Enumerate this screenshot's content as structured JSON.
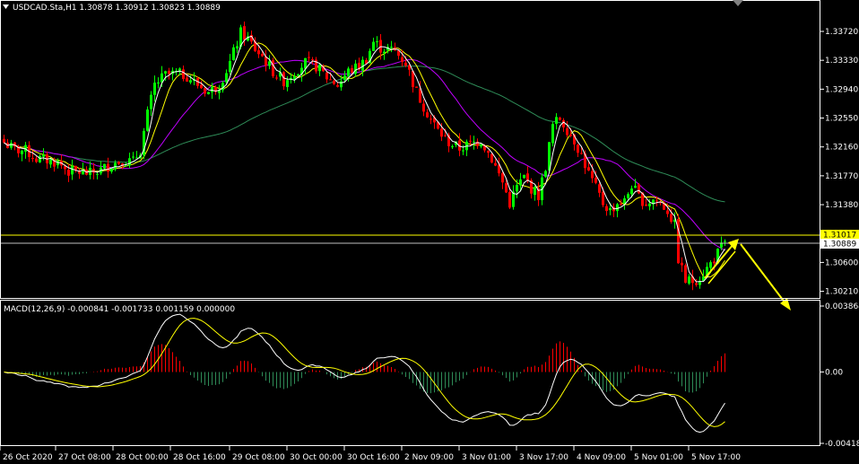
{
  "header": {
    "title": "USDCAD.Sta,H1  1.30878 1.30912 1.30823 1.30889",
    "menu_icon": "triangle-down-icon",
    "scroll_icon": "triangle-down-icon"
  },
  "colors": {
    "background": "#000000",
    "frame": "#ffffff",
    "bull_candle": "#00ff00",
    "bear_candle": "#ff0000",
    "ma_fast": "#ffffff",
    "ma_medium": "#ffff00",
    "ma_slow": "#c000ff",
    "ma_long": "#2e8b57",
    "hist_positive": "#ff0000",
    "hist_negative": "#2e8b57",
    "macd_line": "#ffffff",
    "signal_line": "#ffff00",
    "arrow": "#ffff00",
    "level_line": "#ffff00",
    "bid_line": "#c0c0c0",
    "level_label_bg": "#ffff00",
    "bid_label_bg": "#ffffff"
  },
  "price_panel": {
    "y_ticks": [
      "1.33720",
      "1.33330",
      "1.32940",
      "1.32550",
      "1.32160",
      "1.31770",
      "1.31380",
      "1.30600",
      "1.30210"
    ],
    "level_label": "1.31017",
    "bid_label": "1.30889"
  },
  "macd_panel": {
    "title": "MACD(12,26,9) -0.000841 -0.001733 0.001159 0.000000",
    "y_ticks": [
      "0.003864",
      "0.00",
      "-0.004183"
    ]
  },
  "x_axis": {
    "labels": [
      "26 Oct 2020",
      "27 Oct 08:00",
      "28 Oct 00:00",
      "28 Oct 16:00",
      "29 Oct 08:00",
      "30 Oct 00:00",
      "30 Oct 16:00",
      "2 Nov 09:00",
      "3 Nov 01:00",
      "3 Nov 17:00",
      "4 Nov 09:00",
      "5 Nov 01:00",
      "5 Nov 17:00"
    ]
  },
  "chart_data": [
    {
      "type": "candlestick",
      "title": "USDCAD.Sta,H1",
      "ohlc_last": {
        "open": 1.30878,
        "high": 1.30912,
        "low": 1.30823,
        "close": 1.30889
      },
      "ylim": [
        1.3012,
        1.3412
      ],
      "horizontal_levels": [
        1.31017,
        1.30889
      ],
      "moving_averages": 4,
      "x_labels": [
        "26 Oct 2020",
        "27 Oct 08:00",
        "28 Oct 00:00",
        "28 Oct 16:00",
        "29 Oct 08:00",
        "30 Oct 00:00",
        "30 Oct 16:00",
        "2 Nov 09:00",
        "3 Nov 01:00",
        "3 Nov 17:00",
        "4 Nov 09:00",
        "5 Nov 01:00",
        "5 Nov 17:00"
      ],
      "close_path": [
        [
          0,
          1.3222
        ],
        [
          3,
          1.3212
        ],
        [
          6,
          1.3211
        ],
        [
          9,
          1.32
        ],
        [
          12,
          1.3198
        ],
        [
          15,
          1.3195
        ],
        [
          18,
          1.3183
        ],
        [
          21,
          1.3182
        ],
        [
          24,
          1.318
        ],
        [
          27,
          1.3185
        ],
        [
          30,
          1.3193
        ],
        [
          33,
          1.3198
        ],
        [
          36,
          1.3196
        ],
        [
          38,
          1.3212
        ],
        [
          40,
          1.326
        ],
        [
          42,
          1.33
        ],
        [
          45,
          1.3313
        ],
        [
          48,
          1.3315
        ],
        [
          51,
          1.3312
        ],
        [
          54,
          1.33
        ],
        [
          57,
          1.329
        ],
        [
          60,
          1.33
        ],
        [
          63,
          1.333
        ],
        [
          66,
          1.337
        ],
        [
          68,
          1.3362
        ],
        [
          70,
          1.3348
        ],
        [
          72,
          1.3338
        ],
        [
          75,
          1.3318
        ],
        [
          78,
          1.3305
        ],
        [
          81,
          1.3318
        ],
        [
          84,
          1.333
        ],
        [
          87,
          1.3325
        ],
        [
          90,
          1.331
        ],
        [
          93,
          1.33
        ],
        [
          96,
          1.3318
        ],
        [
          99,
          1.3325
        ],
        [
          101,
          1.3335
        ],
        [
          103,
          1.3358
        ],
        [
          105,
          1.335
        ],
        [
          107,
          1.3348
        ],
        [
          109,
          1.3345
        ],
        [
          112,
          1.333
        ],
        [
          115,
          1.329
        ],
        [
          118,
          1.3262
        ],
        [
          121,
          1.3238
        ],
        [
          124,
          1.3222
        ],
        [
          127,
          1.3214
        ],
        [
          130,
          1.322
        ],
        [
          133,
          1.3225
        ],
        [
          136,
          1.32
        ],
        [
          139,
          1.3168
        ],
        [
          141,
          1.314
        ],
        [
          143,
          1.3162
        ],
        [
          145,
          1.3175
        ],
        [
          147,
          1.316
        ],
        [
          149,
          1.315
        ],
        [
          151,
          1.319
        ],
        [
          153,
          1.3245
        ],
        [
          155,
          1.3255
        ],
        [
          157,
          1.324
        ],
        [
          159,
          1.3225
        ],
        [
          161,
          1.3205
        ],
        [
          163,
          1.318
        ],
        [
          165,
          1.316
        ],
        [
          167,
          1.314
        ],
        [
          169,
          1.313
        ],
        [
          171,
          1.314
        ],
        [
          173,
          1.3142
        ],
        [
          175,
          1.3165
        ],
        [
          177,
          1.3148
        ],
        [
          179,
          1.314
        ],
        [
          181,
          1.3145
        ],
        [
          183,
          1.314
        ],
        [
          185,
          1.313
        ],
        [
          187,
          1.311
        ],
        [
          188,
          1.3065
        ],
        [
          190,
          1.3035
        ],
        [
          192,
          1.3035
        ],
        [
          194,
          1.304
        ],
        [
          196,
          1.3052
        ],
        [
          198,
          1.3065
        ],
        [
          200,
          1.308
        ],
        [
          201,
          1.3089
        ]
      ]
    },
    {
      "type": "macd",
      "title": "MACD(12,26,9) -0.000841 -0.001733 0.001159 0.000000",
      "params": [
        12,
        26,
        9
      ],
      "values": {
        "main": -0.000841,
        "signal": -0.001733,
        "histogram": 0.001159,
        "extra": 0.0
      },
      "ylim": [
        -0.004183,
        0.003864
      ],
      "y_ticks": [
        0.003864,
        0.0,
        -0.004183
      ]
    }
  ]
}
